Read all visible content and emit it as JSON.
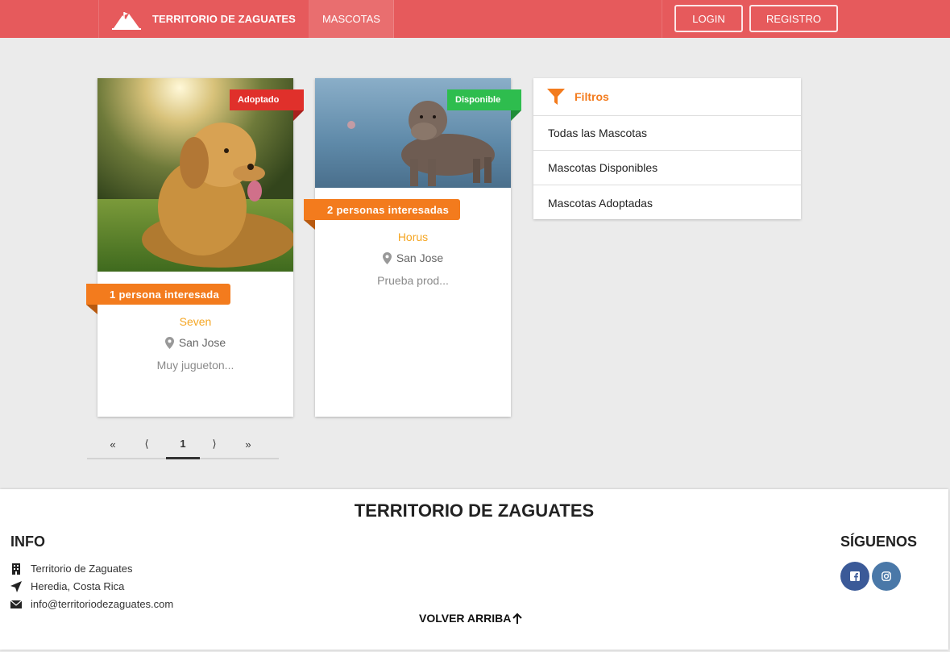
{
  "nav": {
    "brand": "TERRITORIO DE ZAGUATES",
    "mascotas": "MASCOTAS",
    "login": "LOGIN",
    "registro": "REGISTRO"
  },
  "pets": [
    {
      "status": "Adoptado",
      "interest": "1 persona interesada",
      "name": "Seven",
      "location": "San Jose",
      "description": "Muy jugueton...",
      "status_color": "#e0302b"
    },
    {
      "status": "Disponible",
      "interest": "2 personas interesadas",
      "name": "Horus",
      "location": "San Jose",
      "description": "Prueba prod...",
      "status_color": "#2ebd4e"
    }
  ],
  "pagination": {
    "first": "«",
    "prev": "⟨",
    "current": "1",
    "next": "⟩",
    "last": "»"
  },
  "filters": {
    "title": "Filtros",
    "items": [
      "Todas las Mascotas",
      "Mascotas Disponibles",
      "Mascotas Adoptadas"
    ]
  },
  "footer": {
    "title": "TERRITORIO DE ZAGUATES",
    "info_title": "INFO",
    "info_name": "Territorio de Zaguates",
    "info_location": "Heredia, Costa Rica",
    "info_email": "info@territoriodezaguates.com",
    "back_to_top": "VOLVER ARRIBA",
    "social_title": "SÍGUENOS"
  },
  "colors": {
    "navbar": "#e65a5c",
    "accent_orange": "#f37b1d",
    "name_orange": "#f5a623",
    "facebook": "#3b5a98",
    "instagram": "#4a78a8"
  },
  "icons": [
    "mountain-logo-icon",
    "map-marker-icon",
    "filter-icon",
    "building-icon",
    "location-arrow-icon",
    "envelope-icon",
    "arrow-up-icon",
    "facebook-icon",
    "instagram-icon"
  ]
}
